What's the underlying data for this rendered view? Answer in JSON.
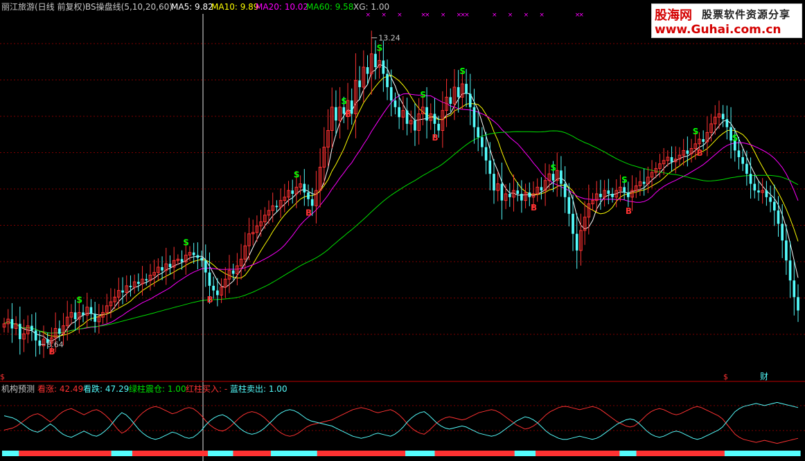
{
  "header": {
    "stock": "丽江旅游(日线 前复权)",
    "indicator": "BS操盘线(5,10,20,60)",
    "ma5": "MA5: 9.82",
    "ma10": "MA10: 9.89",
    "ma20": "MA20: 10.02",
    "ma60": "MA60: 9.58",
    "xg": "XG: 1.00"
  },
  "sub_header": {
    "name": "机构预测",
    "kanzhang": "看涨: 42.49",
    "kandie": "看跌: 47.29",
    "green": "绿柱震仓: 1.00",
    "red": "红柱买入: -",
    "blue": "蓝柱卖出: 1.00"
  },
  "bottom_marks": {
    "s": "$",
    "cai": "财"
  },
  "watermark": {
    "line1": "股海网",
    "line1b": "股票软件资源分享",
    "line2": "www.Guhai.com.cn"
  },
  "colors": {
    "up": "#ff3232",
    "down": "#54fcfc",
    "ma5": "#ffffff",
    "ma10": "#ffff00",
    "ma20": "#ff00ff",
    "ma60": "#00e000",
    "buy": "#ff3232",
    "sell": "#00ff00",
    "kanzhang": "#ff3232",
    "kandie": "#54fcfc",
    "grid": "#800000"
  },
  "chart_data": {
    "type": "candlestick",
    "title": "丽江旅游(日线 前复权)",
    "ylim": [
      8.2,
      13.6
    ],
    "annotations": [
      {
        "label": "13.24",
        "value": 13.24,
        "kind": "high"
      },
      {
        "label": "8.64",
        "value": 8.64,
        "kind": "low"
      }
    ],
    "close": [
      8.95,
      9.02,
      8.88,
      8.95,
      8.72,
      8.8,
      8.92,
      8.85,
      8.7,
      8.62,
      8.72,
      8.66,
      8.74,
      8.88,
      8.8,
      8.92,
      9.05,
      9.12,
      9.02,
      9.12,
      9.08,
      9.2,
      9.1,
      8.98,
      9.05,
      9.12,
      9.22,
      9.28,
      9.35,
      9.45,
      9.42,
      9.52,
      9.5,
      9.58,
      9.55,
      9.62,
      9.6,
      9.68,
      9.72,
      9.8,
      9.75,
      9.85,
      9.8,
      9.9,
      9.92,
      9.88,
      9.98,
      10.02,
      9.98,
      9.94,
      9.9,
      9.72,
      9.52,
      9.45,
      9.38,
      9.5,
      9.62,
      9.75,
      9.7,
      9.82,
      9.92,
      10.12,
      10.3,
      10.32,
      10.42,
      10.48,
      10.58,
      10.65,
      10.72,
      10.7,
      10.8,
      10.85,
      10.95,
      10.9,
      11.0,
      11.05,
      10.92,
      10.82,
      10.72,
      10.95,
      11.3,
      11.6,
      11.85,
      12.2,
      12.0,
      12.2,
      12.1,
      12.3,
      12.1,
      12.6,
      12.5,
      12.8,
      12.7,
      13.0,
      12.8,
      12.9,
      12.7,
      12.5,
      12.3,
      12.2,
      12.05,
      12.15,
      11.95,
      12.0,
      11.85,
      12.1,
      12.2,
      12.0,
      12.1,
      11.95,
      11.85,
      12.15,
      12.35,
      12.25,
      12.5,
      12.35,
      12.55,
      12.4,
      12.2,
      11.9,
      11.75,
      11.6,
      11.4,
      11.2,
      10.95,
      11.05,
      10.8,
      10.9,
      10.85,
      10.95,
      10.9,
      10.8,
      10.92,
      10.85,
      10.9,
      11.0,
      10.95,
      11.1,
      11.2,
      11.1,
      11.25,
      11.05,
      10.85,
      10.6,
      10.3,
      10.05,
      10.35,
      10.55,
      10.75,
      10.8,
      10.9,
      10.85,
      10.95,
      10.9,
      10.85,
      10.95,
      11.0,
      10.92,
      10.85,
      10.95,
      11.02,
      11.08,
      11.05,
      11.15,
      11.22,
      11.28,
      11.35,
      11.4,
      11.45,
      11.38,
      11.42,
      11.48,
      11.55,
      11.5,
      11.58,
      11.65,
      11.72,
      11.68,
      11.82,
      11.95,
      12.05,
      12.1,
      12.02,
      11.9,
      11.7,
      11.55,
      11.45,
      11.35,
      11.2,
      11.05,
      10.95,
      10.92,
      10.95,
      10.85,
      10.78,
      10.65,
      10.45,
      10.2,
      9.9,
      9.6,
      9.35,
      9.15
    ],
    "ma_series": [
      {
        "name": "MA5",
        "period": 5
      },
      {
        "name": "MA10",
        "period": 10
      },
      {
        "name": "MA20",
        "period": 20
      },
      {
        "name": "MA60",
        "period": 60
      }
    ],
    "signals": [
      {
        "i": 12,
        "label": "B"
      },
      {
        "i": 19,
        "label": "S"
      },
      {
        "i": 46,
        "label": "S"
      },
      {
        "i": 52,
        "label": "B"
      },
      {
        "i": 74,
        "label": "S"
      },
      {
        "i": 77,
        "label": "B"
      },
      {
        "i": 86,
        "label": "S"
      },
      {
        "i": 87,
        "label": "B"
      },
      {
        "i": 95,
        "label": "S"
      },
      {
        "i": 106,
        "label": "S"
      },
      {
        "i": 109,
        "label": "B"
      },
      {
        "i": 116,
        "label": "S"
      },
      {
        "i": 134,
        "label": "B"
      },
      {
        "i": 139,
        "label": "S"
      },
      {
        "i": 157,
        "label": "S"
      },
      {
        "i": 158,
        "label": "B"
      },
      {
        "i": 175,
        "label": "S"
      },
      {
        "i": 176,
        "label": "B"
      },
      {
        "i": 185,
        "label": "S"
      }
    ],
    "xg_marks": [
      92,
      96,
      100,
      106,
      107,
      111,
      115,
      116,
      117,
      124,
      128,
      132,
      136,
      145,
      146
    ],
    "oscillator": {
      "kanzhang": [
        36,
        38,
        40,
        44,
        50,
        56,
        62,
        66,
        68,
        64,
        58,
        52,
        58,
        66,
        72,
        76,
        78,
        74,
        70,
        66,
        70,
        74,
        76,
        72,
        66,
        58,
        48,
        38,
        30,
        34,
        42,
        52,
        62,
        70,
        76,
        80,
        82,
        80,
        76,
        72,
        68,
        70,
        74,
        78,
        80,
        78,
        72,
        64,
        54,
        46,
        40,
        36,
        34,
        38,
        44,
        52,
        60,
        66,
        70,
        72,
        70,
        66,
        60,
        52,
        44,
        36,
        30,
        26,
        24,
        26,
        30,
        36,
        42,
        46,
        48,
        50,
        52,
        54,
        56,
        60,
        64,
        68,
        72,
        76,
        78,
        80,
        78,
        76,
        72,
        70,
        72,
        74,
        76,
        72,
        66,
        58,
        48,
        40,
        34,
        30,
        28,
        34,
        42,
        50,
        56,
        60,
        62,
        60,
        58,
        56,
        58,
        62,
        66,
        70,
        72,
        74,
        76,
        74,
        70,
        64,
        58,
        52,
        46,
        42,
        38,
        40,
        44,
        50,
        58,
        66,
        72,
        76,
        80,
        82,
        82,
        80,
        78,
        76,
        78,
        80,
        82,
        80,
        76,
        70,
        64,
        58,
        52,
        48,
        44,
        42,
        44,
        50,
        58,
        66,
        72,
        76,
        78,
        76,
        72,
        68,
        66,
        68,
        72,
        76,
        80,
        82,
        80,
        76,
        72,
        68,
        64,
        58,
        48,
        38,
        28,
        22,
        18,
        16,
        14,
        12,
        14,
        16,
        14,
        12,
        10,
        12,
        14,
        16,
        18,
        20
      ],
      "kandie": [
        64,
        62,
        60,
        56,
        50,
        44,
        38,
        34,
        32,
        36,
        42,
        48,
        42,
        34,
        28,
        24,
        22,
        26,
        30,
        34,
        30,
        26,
        24,
        28,
        34,
        42,
        52,
        62,
        70,
        66,
        58,
        48,
        38,
        30,
        24,
        20,
        18,
        20,
        24,
        28,
        32,
        30,
        26,
        22,
        20,
        22,
        28,
        36,
        46,
        54,
        60,
        64,
        66,
        62,
        56,
        48,
        40,
        34,
        30,
        28,
        30,
        34,
        40,
        48,
        56,
        64,
        70,
        74,
        76,
        74,
        70,
        64,
        58,
        54,
        52,
        50,
        48,
        46,
        44,
        40,
        36,
        32,
        28,
        24,
        22,
        20,
        22,
        24,
        28,
        30,
        28,
        26,
        24,
        28,
        34,
        42,
        52,
        60,
        66,
        70,
        72,
        66,
        58,
        50,
        44,
        40,
        38,
        40,
        42,
        44,
        42,
        38,
        34,
        30,
        28,
        26,
        24,
        26,
        30,
        36,
        42,
        48,
        54,
        58,
        62,
        60,
        56,
        50,
        42,
        34,
        28,
        24,
        20,
        18,
        18,
        20,
        22,
        24,
        22,
        20,
        18,
        20,
        24,
        30,
        36,
        42,
        48,
        52,
        56,
        58,
        56,
        50,
        42,
        34,
        28,
        24,
        22,
        24,
        28,
        32,
        34,
        32,
        28,
        24,
        20,
        18,
        20,
        24,
        28,
        32,
        36,
        42,
        52,
        62,
        72,
        78,
        82,
        84,
        86,
        88,
        86,
        84,
        86,
        88,
        90,
        88,
        86,
        84,
        82,
        80
      ]
    }
  }
}
